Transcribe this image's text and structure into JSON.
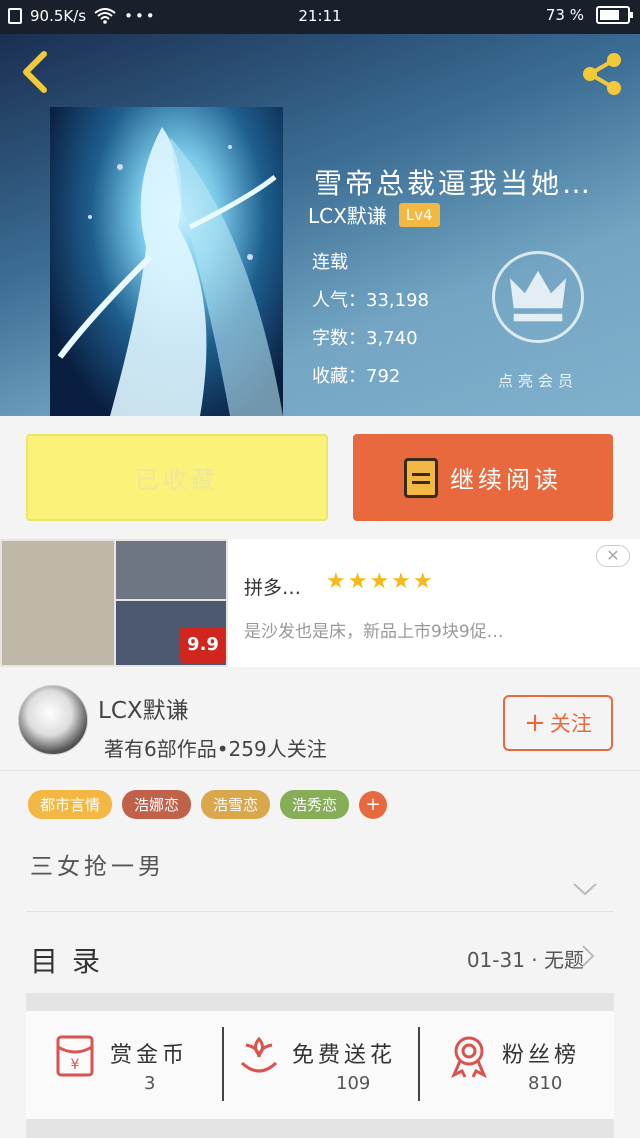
{
  "status_bar": {
    "speed": "90.5K/s",
    "time": "21:11",
    "battery": "73 %",
    "battery_level": 0.73
  },
  "book": {
    "title": "雪帝总裁逼我当她…",
    "author": "LCX默谦",
    "level": "Lv4",
    "status": "连载",
    "popularity_label": "人气：",
    "popularity": "33,198",
    "words_label": "字数：",
    "words": "3,740",
    "favorites_label": "收藏：",
    "favorites": "792",
    "vip_label": "点亮会员"
  },
  "actions": {
    "collected_label": "已收藏",
    "read_label": "继续阅读"
  },
  "ad": {
    "title": "拼多…",
    "stars": "★★★★★",
    "description": "是沙发也是床，新品上市9块9促…",
    "price_badge": "9.9",
    "close_label": "✕"
  },
  "author_section": {
    "name": "LCX默谦",
    "info": "著有6部作品•259人关注",
    "follow_label": "关注"
  },
  "tags": [
    {
      "label": "都市言情",
      "color": "#f3b844"
    },
    {
      "label": "浩娜恋",
      "color": "#c0614a"
    },
    {
      "label": "浩雪恋",
      "color": "#d9a84c"
    },
    {
      "label": "浩秀恋",
      "color": "#86ad58"
    }
  ],
  "summary": "三女抢一男",
  "catalog": {
    "label": "目录",
    "update": "01-31 · 无题"
  },
  "rewards": [
    {
      "label": "赏金币",
      "count": "3"
    },
    {
      "label": "免费送花",
      "count": "109"
    },
    {
      "label": "粉丝榜",
      "count": "810"
    }
  ],
  "colors": {
    "accent": "#e8693d",
    "collected_bg": "#fbf27a",
    "badge": "#f3b844"
  }
}
